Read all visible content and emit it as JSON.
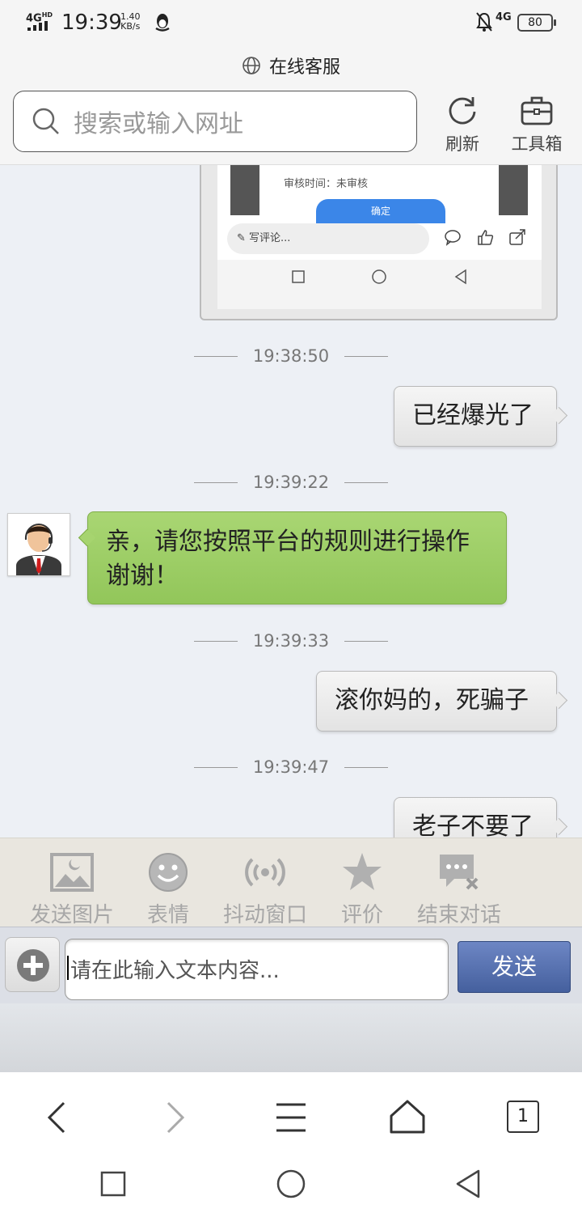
{
  "status_bar": {
    "network_type": "4G",
    "network_sup": "HD",
    "time": "19:39",
    "speed_value": "1.40",
    "speed_unit": "KB/s",
    "right_network": "4G",
    "battery": "80"
  },
  "page": {
    "title": "在线客服"
  },
  "browser": {
    "search_placeholder": "搜索或输入网址",
    "refresh_label": "刷新",
    "toolbox_label": "工具箱",
    "tab_count": "1"
  },
  "embedded_screenshot": {
    "audit_text": "审核时间：未审核",
    "confirm_label": "确定",
    "comment_placeholder": "写评论..."
  },
  "chat": {
    "messages": [
      {
        "timestamp": "19:38:50",
        "side": "right",
        "text": "已经爆光了"
      },
      {
        "timestamp": "19:39:22",
        "side": "left",
        "text": "亲，请您按照平台的规则进行操作谢谢！"
      },
      {
        "timestamp": "19:39:33",
        "side": "right",
        "text": "滚你妈的，死骗子"
      },
      {
        "timestamp": "19:39:47",
        "side": "right",
        "text": "老子不要了"
      }
    ]
  },
  "actions": [
    {
      "label": "发送图片",
      "icon": "image-icon"
    },
    {
      "label": "表情",
      "icon": "smiley-icon"
    },
    {
      "label": "抖动窗口",
      "icon": "vibrate-icon"
    },
    {
      "label": "评价",
      "icon": "star-icon"
    },
    {
      "label": "结束对话",
      "icon": "end-chat-icon"
    }
  ],
  "composer": {
    "placeholder": "请在此输入文本内容...",
    "send_label": "发送"
  },
  "colors": {
    "chat_background": "#edf0f5",
    "agent_bubble": "#9ccd62",
    "send_button": "#4f68a8"
  }
}
